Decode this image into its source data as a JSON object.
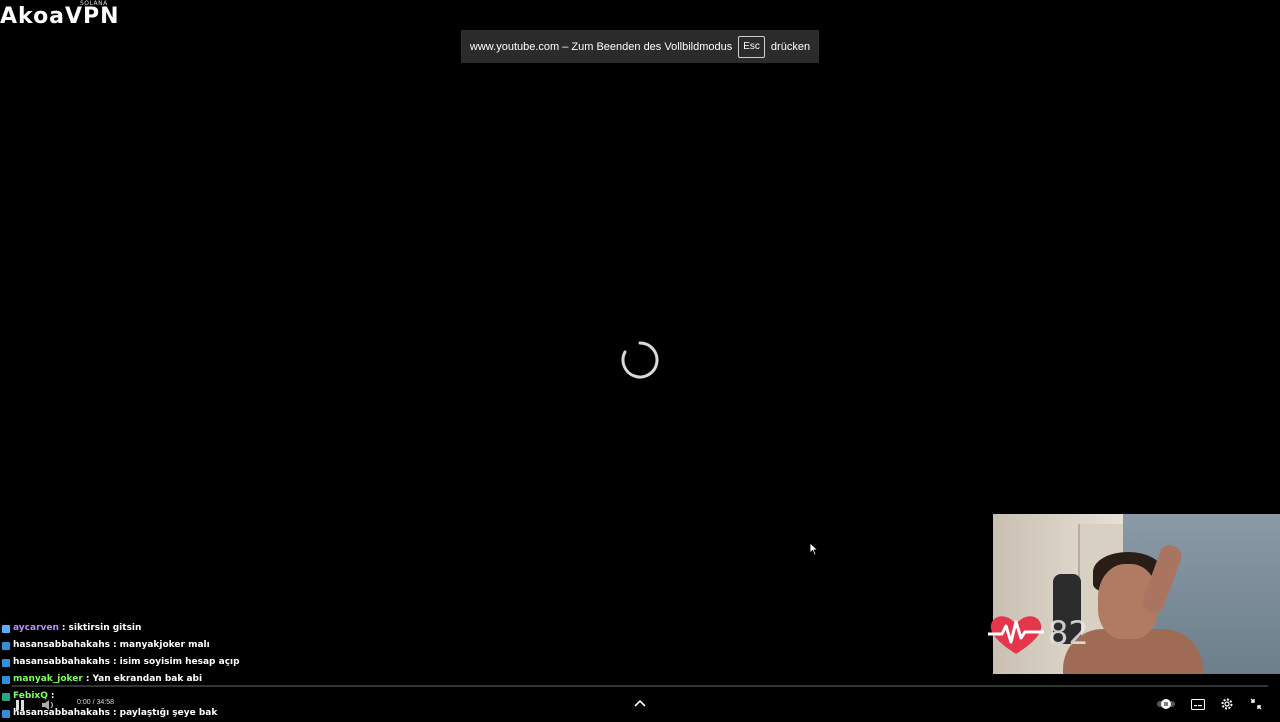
{
  "overlay": {
    "logo_text": "AkoaVPN",
    "logo_sub": "SOLANA"
  },
  "fullscreen_toast": {
    "message": "www.youtube.com – Zum Beenden des Vollbildmodus",
    "key": "Esc",
    "suffix": "drücken"
  },
  "webcam": {
    "heart_rate": "82"
  },
  "chat": [
    {
      "user": "aycarven",
      "sep": ":",
      "msg": "siktirsin gitsin",
      "color": "#c08bff",
      "badge_color": "#5ab0ff"
    },
    {
      "user": "hasansabbahakahs",
      "sep": ":",
      "msg": "manyakjoker malı",
      "color": "#ffffff",
      "badge_color": "#2f8fe0"
    },
    {
      "user": "hasansabbahakahs",
      "sep": ":",
      "msg": "isim soyisim hesap açıp",
      "color": "#ffffff",
      "badge_color": "#2f8fe0"
    },
    {
      "user": "manyak_joker",
      "sep": ":",
      "msg": "Yan ekrandan bak abi",
      "color": "#7dff5a",
      "badge_color": "#2f8fe0"
    },
    {
      "user": "FebixQ",
      "sep": ":",
      "msg": "",
      "color": "#7dff5a",
      "badge_color": "#2aa77a"
    },
    {
      "user": "hasansabbahakahs",
      "sep": ":",
      "msg": "paylaştığı şeye bak",
      "color": "#ffffff",
      "badge_color": "#2f8fe0"
    }
  ],
  "player": {
    "time": "0:00 / 34:58"
  },
  "colors": {
    "background": "#000000",
    "toast_bg": "#2b2b2b",
    "heart": "#e5374b"
  }
}
